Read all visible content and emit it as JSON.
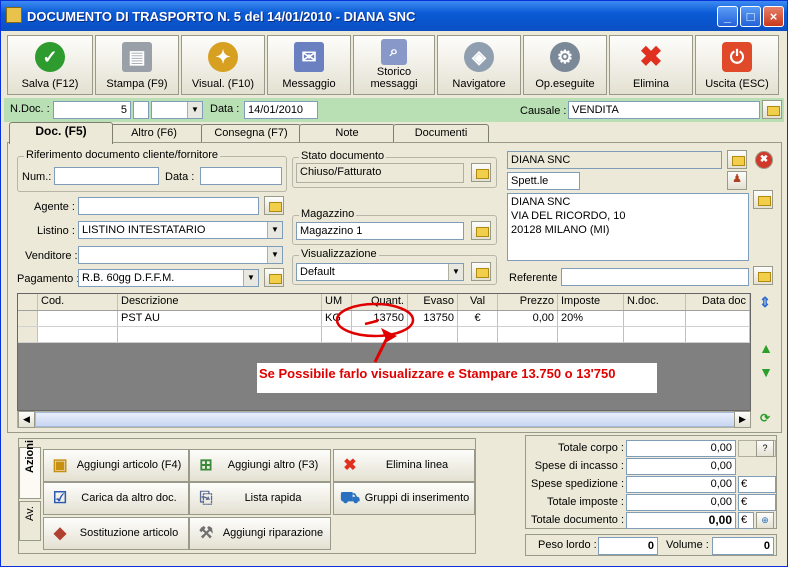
{
  "window": {
    "title": "DOCUMENTO DI TRASPORTO N. 5  del 14/01/2010 - DIANA  SNC",
    "min": "_",
    "max": "□",
    "close": "×"
  },
  "toolbar": {
    "save": "Salva (F12)",
    "print": "Stampa (F9)",
    "view": "Visual. (F10)",
    "message": "Messaggio",
    "history_l1": "Storico",
    "history_l2": "messaggi",
    "navigator": "Navigatore",
    "done_ops": "Op.eseguite",
    "delete": "Elimina",
    "exit": "Uscita (ESC)"
  },
  "header": {
    "ndoc_label": "N.Doc. :",
    "ndoc_value": "5",
    "data_label": "Data :",
    "data_value": "14/01/2010",
    "causale_label": "Causale :",
    "causale_value": "VENDITA"
  },
  "tabs": [
    "Doc. (F5)",
    "Altro (F6)",
    "Consegna (F7)",
    "Note",
    "Documenti"
  ],
  "doc": {
    "riferimento_title": "Riferimento documento cliente/fornitore",
    "num_label": "Num.:",
    "num_value": "",
    "data_label": "Data :",
    "data_value": "",
    "agente_label": "Agente :",
    "agente_value": "",
    "listino_label": "Listino :",
    "listino_value": "LISTINO INTESTATARIO",
    "venditore_label": "Venditore :",
    "venditore_value": "",
    "pagamento_label": "Pagamento :",
    "pagamento_value": "R.B. 60gg D.F.F.M.",
    "stato_title": "Stato documento",
    "stato_value": "Chiuso/Fatturato",
    "magazzino_title": "Magazzino",
    "magazzino_value": "Magazzino 1",
    "visualizzazione_title": "Visualizzazione",
    "visualizzazione_value": "Default",
    "cliente_name": "DIANA  SNC",
    "spett": "Spett.le",
    "address_l1": "DIANA  SNC",
    "address_l2": "VIA DEL RICORDO, 10",
    "address_l3": "20128 MILANO (MI)",
    "referente_label": "Referente",
    "referente_value": ""
  },
  "grid": {
    "columns": [
      "Cod.",
      "Descrizione",
      "UM",
      "Quant.",
      "Evaso",
      "Val",
      "Prezzo",
      "Imposte",
      "N.doc.",
      "Data doc"
    ],
    "rows": [
      [
        "",
        "PST AU",
        "KG",
        "13750",
        "13750",
        "€",
        "0,00",
        "20%",
        "",
        ""
      ]
    ]
  },
  "annotation": {
    "text": "Se Possibile farlo visualizzare e Stampare 13.750 o 13'750"
  },
  "actions": {
    "tab_azioni": "Azioni",
    "tab_av": "Av.",
    "add_article": "Aggiungi articolo (F4)",
    "add_other": "Aggiungi altro (F3)",
    "delete_line": "Elimina linea",
    "load_other_doc": "Carica da altro doc.",
    "quick_list": "Lista rapida",
    "insert_groups": "Gruppi di inserimento",
    "replace_article": "Sostituzione articolo",
    "add_repair": "Aggiungi riparazione"
  },
  "totals": {
    "corpo_label": "Totale corpo :",
    "corpo_value": "0,00",
    "incasso_label": "Spese di incasso :",
    "incasso_value": "0,00",
    "spedizione_label": "Spese spedizione :",
    "spedizione_value": "0,00",
    "imposte_label": "Totale imposte :",
    "imposte_value": "0,00",
    "documento_label": "Totale documento :",
    "documento_value": "0,00",
    "currency": "€",
    "help": "?"
  },
  "weights": {
    "peso_label": "Peso lordo :",
    "peso_value": "0",
    "volume_label": "Volume :",
    "volume_value": "0"
  },
  "colors": {
    "title_blue": "#0a5bd6",
    "green_band": "#b9e0b4",
    "annotation_red": "#e00000"
  }
}
